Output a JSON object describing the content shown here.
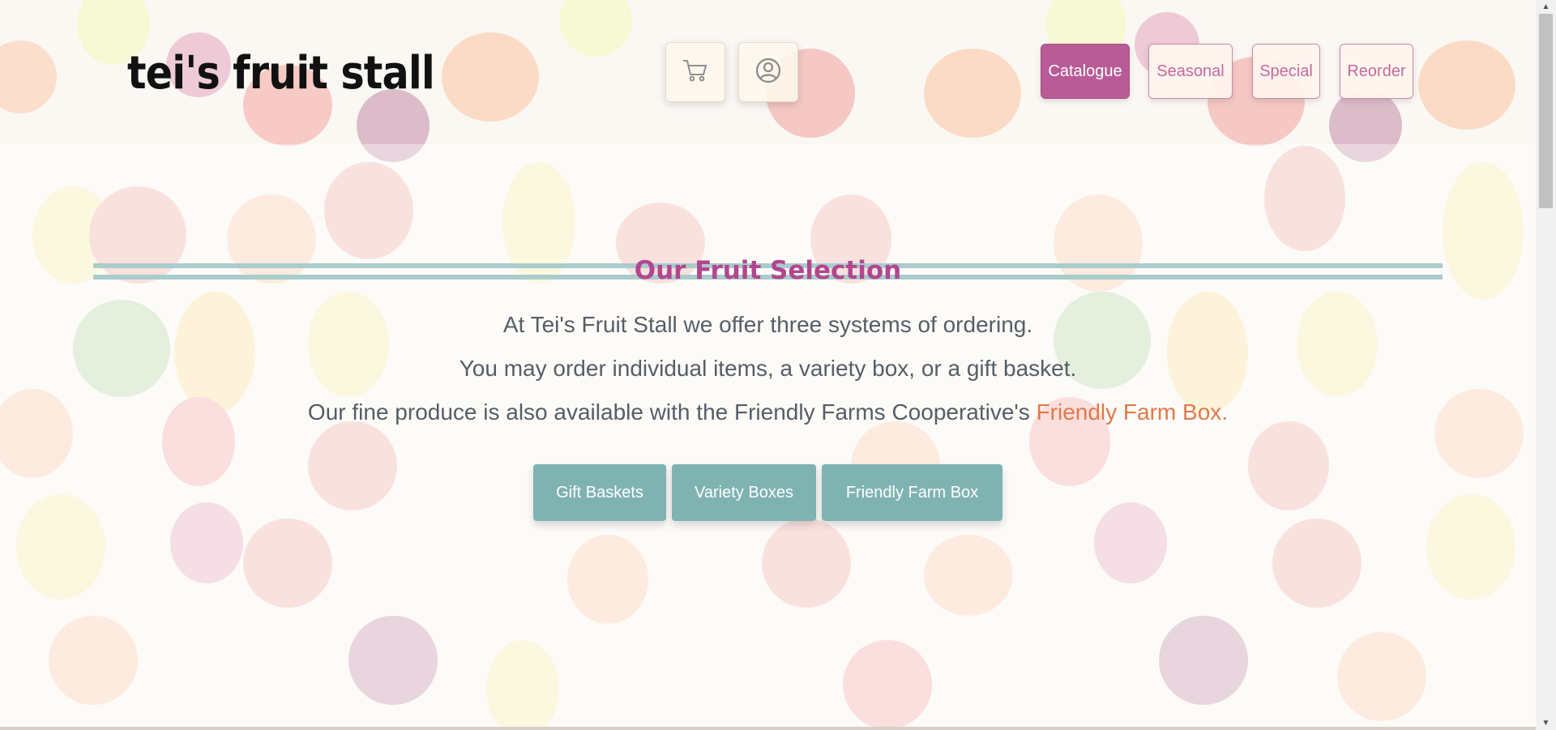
{
  "site": {
    "logo": "tei's fruit stall"
  },
  "header": {
    "icons": [
      {
        "name": "cart-icon"
      },
      {
        "name": "user-icon"
      }
    ],
    "nav": [
      {
        "label": "Catalogue",
        "active": true
      },
      {
        "label": "Seasonal",
        "active": false
      },
      {
        "label": "Special",
        "active": false
      },
      {
        "label": "Reorder",
        "active": false
      }
    ]
  },
  "main": {
    "title": "Our Fruit Selection",
    "line1": "At Tei's Fruit Stall we offer three systems of ordering.",
    "line2": "You may order individual items, a variety box, or a gift basket.",
    "line3_prefix": "Our fine produce is also available with the Friendly Farms Cooperative's ",
    "line3_link": "Friendly Farm Box.",
    "buttons": [
      {
        "label": "Gift Baskets"
      },
      {
        "label": "Variety Boxes"
      },
      {
        "label": "Friendly Farm Box"
      }
    ]
  },
  "colors": {
    "accent_pink": "#b85b96",
    "title_pink": "#b3468f",
    "link_orange": "#e07a4a",
    "button_teal": "#7fb3b2",
    "rule_teal": "#a9cccc"
  }
}
